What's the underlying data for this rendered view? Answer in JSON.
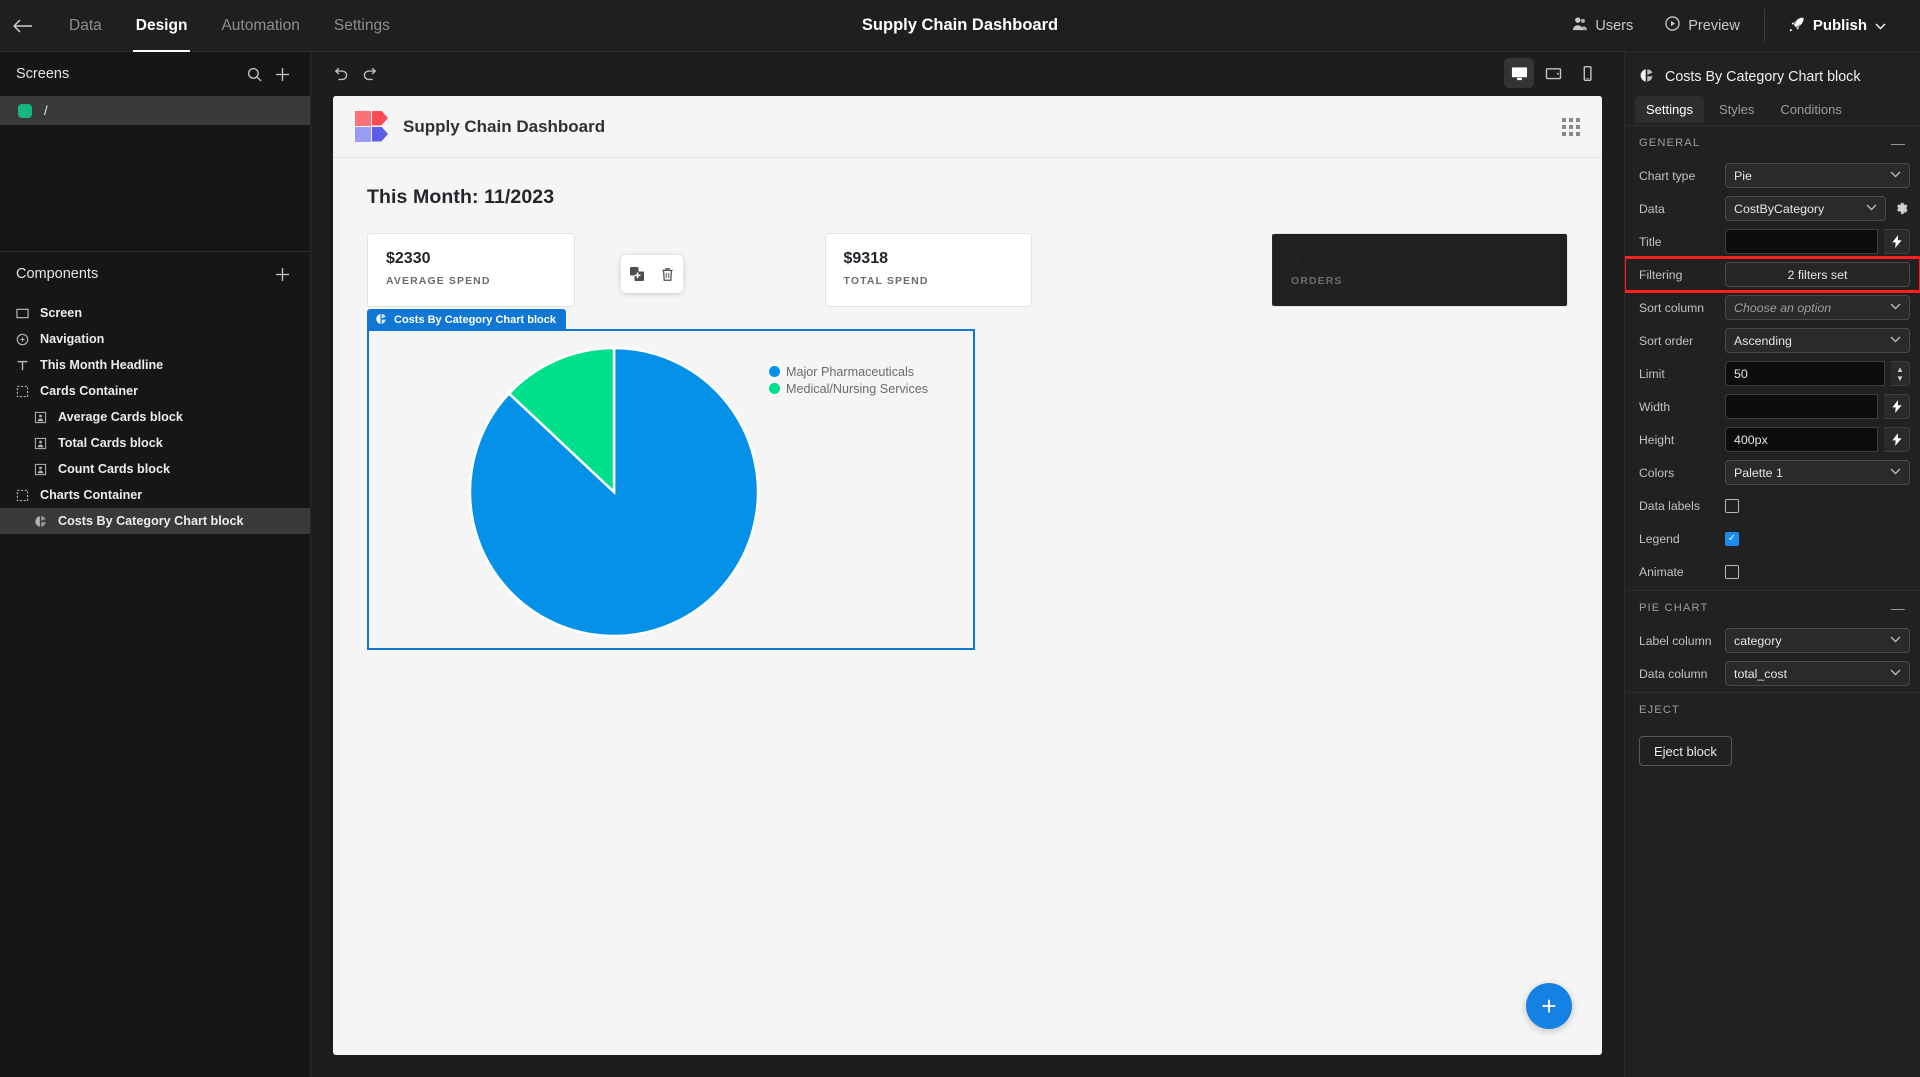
{
  "topbar": {
    "back_icon": "arrow-left-icon",
    "nav": [
      {
        "label": "Data",
        "active": false
      },
      {
        "label": "Design",
        "active": true
      },
      {
        "label": "Automation",
        "active": false
      },
      {
        "label": "Settings",
        "active": false
      }
    ],
    "title": "Supply Chain Dashboard",
    "users_label": "Users",
    "preview_label": "Preview",
    "publish_label": "Publish"
  },
  "left_panel": {
    "screens_heading": "Screens",
    "screens": [
      {
        "label": "/",
        "color": "#16b581",
        "selected": true
      }
    ],
    "components_heading": "Components",
    "components": [
      {
        "label": "Screen",
        "icon": "screen-icon",
        "indent": false,
        "selected": false
      },
      {
        "label": "Navigation",
        "icon": "navigation-icon",
        "indent": false,
        "selected": false
      },
      {
        "label": "This Month Headline",
        "icon": "text-icon",
        "indent": false,
        "selected": false
      },
      {
        "label": "Cards Container",
        "icon": "container-icon",
        "indent": false,
        "selected": false
      },
      {
        "label": "Average Cards block",
        "icon": "card-icon",
        "indent": true,
        "selected": false
      },
      {
        "label": "Total Cards block",
        "icon": "card-icon",
        "indent": true,
        "selected": false
      },
      {
        "label": "Count Cards block",
        "icon": "card-icon",
        "indent": true,
        "selected": false
      },
      {
        "label": "Charts Container",
        "icon": "container-icon",
        "indent": false,
        "selected": false
      },
      {
        "label": "Costs By Category Chart block",
        "icon": "pie-icon",
        "indent": true,
        "selected": true
      }
    ]
  },
  "canvas_bar": {
    "undo_icon": "undo-icon",
    "redo_icon": "redo-icon",
    "devices": [
      {
        "name": "desktop",
        "active": true
      },
      {
        "name": "tablet",
        "active": false
      },
      {
        "name": "mobile",
        "active": false
      }
    ]
  },
  "dashboard": {
    "title": "Supply Chain Dashboard",
    "month_headline": "This Month: 11/2023",
    "cards": [
      {
        "value": "$2330",
        "label": "AVERAGE SPEND"
      },
      {
        "value": "$9318",
        "label": "TOTAL SPEND"
      },
      {
        "value": "4",
        "label": "ORDERS"
      }
    ],
    "float_tools": [
      {
        "name": "duplicate-icon"
      },
      {
        "name": "delete-icon"
      }
    ],
    "selected_block_badge": "Costs By Category Chart block",
    "fab_label": "+"
  },
  "chart_data": {
    "type": "pie",
    "title": "",
    "labels": [
      "Major Pharmaceuticals",
      "Medical/Nursing Services"
    ],
    "values": [
      87,
      13
    ],
    "colors": [
      "#0591e8",
      "#00e08c"
    ],
    "legend": true,
    "legend_position": "right",
    "data_labels": false,
    "label_column": "category",
    "data_column": "total_cost"
  },
  "right_panel": {
    "block_title": "Costs By Category Chart block",
    "block_icon": "pie-icon",
    "tabs": [
      {
        "label": "Settings",
        "active": true
      },
      {
        "label": "Styles",
        "active": false
      },
      {
        "label": "Conditions",
        "active": false
      }
    ],
    "general_heading": "GENERAL",
    "chart_type_label": "Chart type",
    "chart_type_value": "Pie",
    "data_label": "Data",
    "data_value": "CostByCategory",
    "title_label": "Title",
    "title_value": "",
    "filtering_label": "Filtering",
    "filtering_value": "2 filters set",
    "sort_column_label": "Sort column",
    "sort_column_value": "Choose an option",
    "sort_order_label": "Sort order",
    "sort_order_value": "Ascending",
    "limit_label": "Limit",
    "limit_value": "50",
    "width_label": "Width",
    "width_value": "",
    "height_label": "Height",
    "height_value": "400px",
    "colors_label": "Colors",
    "colors_value": "Palette 1",
    "data_labels_label": "Data labels",
    "data_labels_checked": false,
    "legend_label": "Legend",
    "legend_checked": true,
    "animate_label": "Animate",
    "animate_checked": false,
    "pie_chart_heading": "PIE CHART",
    "label_column_label": "Label column",
    "label_column_value": "category",
    "data_column_label": "Data column",
    "data_column_value": "total_cost",
    "eject_heading": "EJECT",
    "eject_button": "Eject block",
    "highlight_color": "#ff1f1f"
  }
}
